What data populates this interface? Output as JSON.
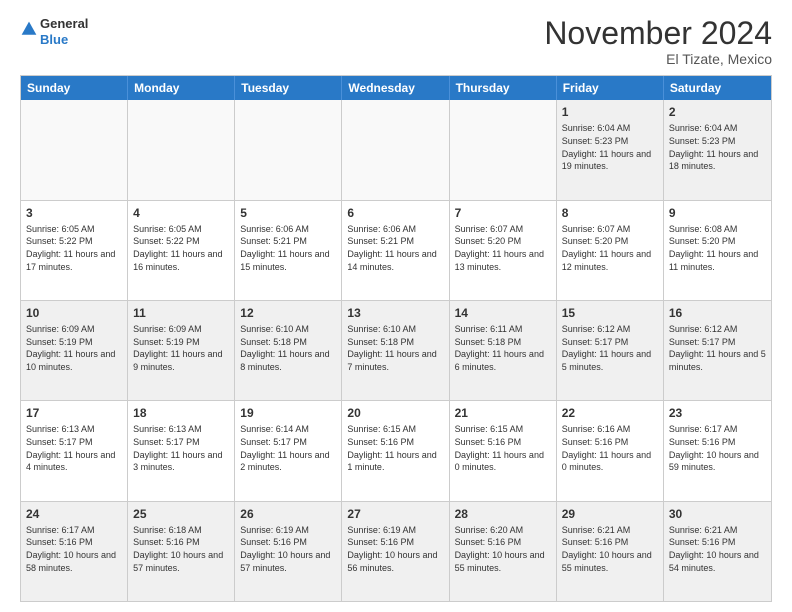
{
  "header": {
    "logo_general": "General",
    "logo_blue": "Blue",
    "month_title": "November 2024",
    "location": "El Tizate, Mexico"
  },
  "weekdays": [
    "Sunday",
    "Monday",
    "Tuesday",
    "Wednesday",
    "Thursday",
    "Friday",
    "Saturday"
  ],
  "rows": [
    [
      {
        "day": "",
        "text": "",
        "empty": true
      },
      {
        "day": "",
        "text": "",
        "empty": true
      },
      {
        "day": "",
        "text": "",
        "empty": true
      },
      {
        "day": "",
        "text": "",
        "empty": true
      },
      {
        "day": "",
        "text": "",
        "empty": true
      },
      {
        "day": "1",
        "text": "Sunrise: 6:04 AM\nSunset: 5:23 PM\nDaylight: 11 hours and 19 minutes.",
        "empty": false,
        "shaded": true
      },
      {
        "day": "2",
        "text": "Sunrise: 6:04 AM\nSunset: 5:23 PM\nDaylight: 11 hours and 18 minutes.",
        "empty": false,
        "shaded": true
      }
    ],
    [
      {
        "day": "3",
        "text": "Sunrise: 6:05 AM\nSunset: 5:22 PM\nDaylight: 11 hours and 17 minutes.",
        "empty": false,
        "shaded": false
      },
      {
        "day": "4",
        "text": "Sunrise: 6:05 AM\nSunset: 5:22 PM\nDaylight: 11 hours and 16 minutes.",
        "empty": false,
        "shaded": false
      },
      {
        "day": "5",
        "text": "Sunrise: 6:06 AM\nSunset: 5:21 PM\nDaylight: 11 hours and 15 minutes.",
        "empty": false,
        "shaded": false
      },
      {
        "day": "6",
        "text": "Sunrise: 6:06 AM\nSunset: 5:21 PM\nDaylight: 11 hours and 14 minutes.",
        "empty": false,
        "shaded": false
      },
      {
        "day": "7",
        "text": "Sunrise: 6:07 AM\nSunset: 5:20 PM\nDaylight: 11 hours and 13 minutes.",
        "empty": false,
        "shaded": false
      },
      {
        "day": "8",
        "text": "Sunrise: 6:07 AM\nSunset: 5:20 PM\nDaylight: 11 hours and 12 minutes.",
        "empty": false,
        "shaded": false
      },
      {
        "day": "9",
        "text": "Sunrise: 6:08 AM\nSunset: 5:20 PM\nDaylight: 11 hours and 11 minutes.",
        "empty": false,
        "shaded": false
      }
    ],
    [
      {
        "day": "10",
        "text": "Sunrise: 6:09 AM\nSunset: 5:19 PM\nDaylight: 11 hours and 10 minutes.",
        "empty": false,
        "shaded": true
      },
      {
        "day": "11",
        "text": "Sunrise: 6:09 AM\nSunset: 5:19 PM\nDaylight: 11 hours and 9 minutes.",
        "empty": false,
        "shaded": true
      },
      {
        "day": "12",
        "text": "Sunrise: 6:10 AM\nSunset: 5:18 PM\nDaylight: 11 hours and 8 minutes.",
        "empty": false,
        "shaded": true
      },
      {
        "day": "13",
        "text": "Sunrise: 6:10 AM\nSunset: 5:18 PM\nDaylight: 11 hours and 7 minutes.",
        "empty": false,
        "shaded": true
      },
      {
        "day": "14",
        "text": "Sunrise: 6:11 AM\nSunset: 5:18 PM\nDaylight: 11 hours and 6 minutes.",
        "empty": false,
        "shaded": true
      },
      {
        "day": "15",
        "text": "Sunrise: 6:12 AM\nSunset: 5:17 PM\nDaylight: 11 hours and 5 minutes.",
        "empty": false,
        "shaded": true
      },
      {
        "day": "16",
        "text": "Sunrise: 6:12 AM\nSunset: 5:17 PM\nDaylight: 11 hours and 5 minutes.",
        "empty": false,
        "shaded": true
      }
    ],
    [
      {
        "day": "17",
        "text": "Sunrise: 6:13 AM\nSunset: 5:17 PM\nDaylight: 11 hours and 4 minutes.",
        "empty": false,
        "shaded": false
      },
      {
        "day": "18",
        "text": "Sunrise: 6:13 AM\nSunset: 5:17 PM\nDaylight: 11 hours and 3 minutes.",
        "empty": false,
        "shaded": false
      },
      {
        "day": "19",
        "text": "Sunrise: 6:14 AM\nSunset: 5:17 PM\nDaylight: 11 hours and 2 minutes.",
        "empty": false,
        "shaded": false
      },
      {
        "day": "20",
        "text": "Sunrise: 6:15 AM\nSunset: 5:16 PM\nDaylight: 11 hours and 1 minute.",
        "empty": false,
        "shaded": false
      },
      {
        "day": "21",
        "text": "Sunrise: 6:15 AM\nSunset: 5:16 PM\nDaylight: 11 hours and 0 minutes.",
        "empty": false,
        "shaded": false
      },
      {
        "day": "22",
        "text": "Sunrise: 6:16 AM\nSunset: 5:16 PM\nDaylight: 11 hours and 0 minutes.",
        "empty": false,
        "shaded": false
      },
      {
        "day": "23",
        "text": "Sunrise: 6:17 AM\nSunset: 5:16 PM\nDaylight: 10 hours and 59 minutes.",
        "empty": false,
        "shaded": false
      }
    ],
    [
      {
        "day": "24",
        "text": "Sunrise: 6:17 AM\nSunset: 5:16 PM\nDaylight: 10 hours and 58 minutes.",
        "empty": false,
        "shaded": true
      },
      {
        "day": "25",
        "text": "Sunrise: 6:18 AM\nSunset: 5:16 PM\nDaylight: 10 hours and 57 minutes.",
        "empty": false,
        "shaded": true
      },
      {
        "day": "26",
        "text": "Sunrise: 6:19 AM\nSunset: 5:16 PM\nDaylight: 10 hours and 57 minutes.",
        "empty": false,
        "shaded": true
      },
      {
        "day": "27",
        "text": "Sunrise: 6:19 AM\nSunset: 5:16 PM\nDaylight: 10 hours and 56 minutes.",
        "empty": false,
        "shaded": true
      },
      {
        "day": "28",
        "text": "Sunrise: 6:20 AM\nSunset: 5:16 PM\nDaylight: 10 hours and 55 minutes.",
        "empty": false,
        "shaded": true
      },
      {
        "day": "29",
        "text": "Sunrise: 6:21 AM\nSunset: 5:16 PM\nDaylight: 10 hours and 55 minutes.",
        "empty": false,
        "shaded": true
      },
      {
        "day": "30",
        "text": "Sunrise: 6:21 AM\nSunset: 5:16 PM\nDaylight: 10 hours and 54 minutes.",
        "empty": false,
        "shaded": true
      }
    ]
  ]
}
